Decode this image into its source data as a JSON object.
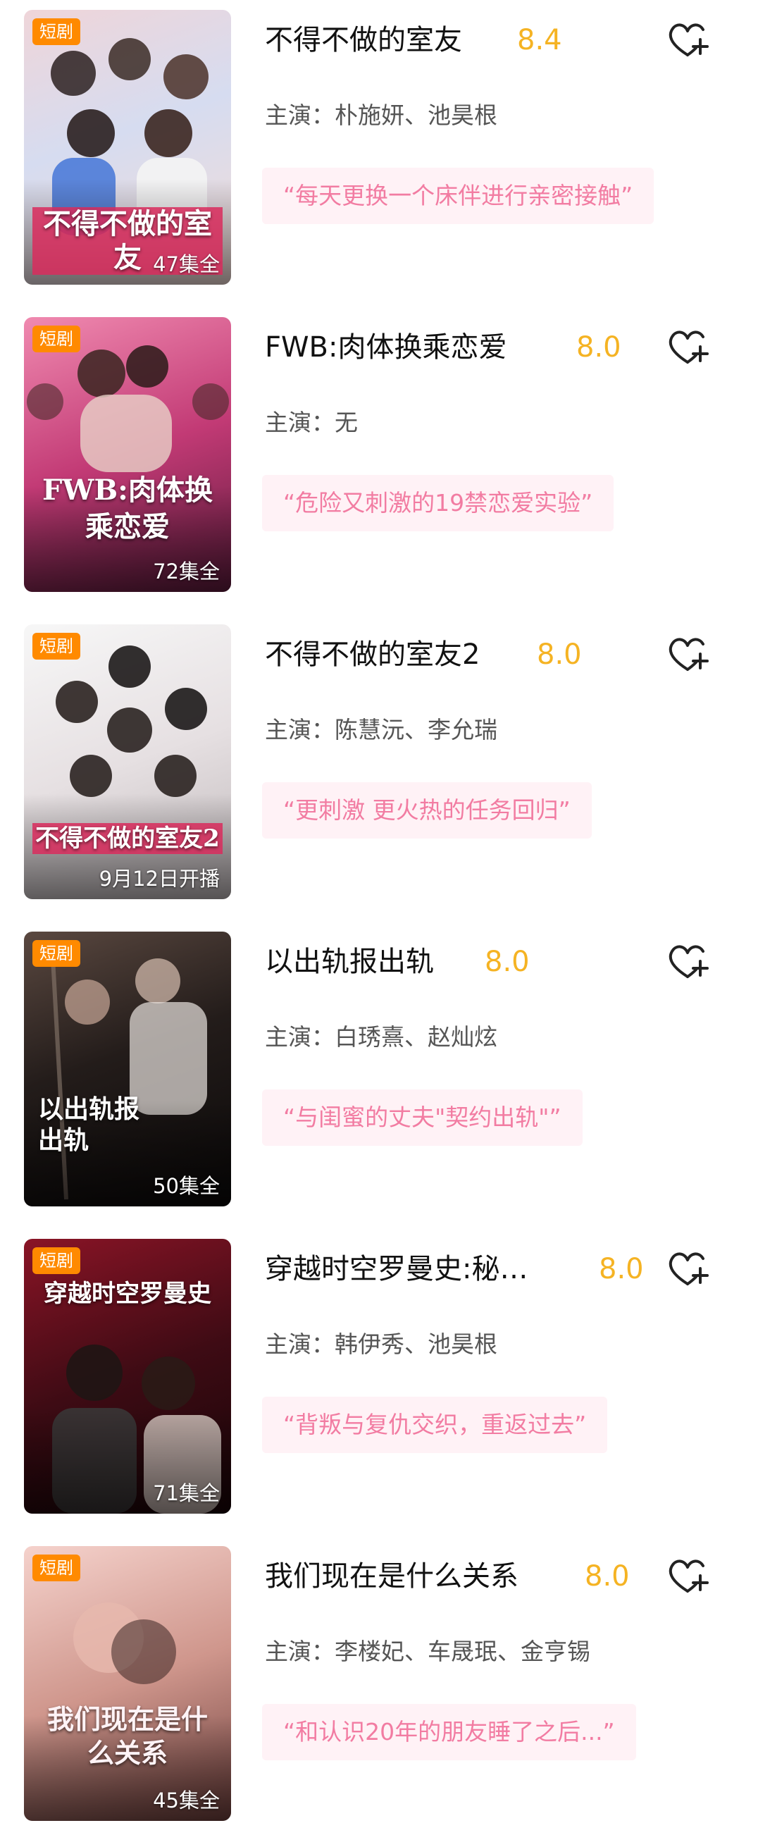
{
  "items": [
    {
      "badge": "短剧",
      "poster_title": "不得不做的室友",
      "episodes": "47集全",
      "title": "不得不做的室友",
      "score": "8.4",
      "cast_label": "主演：朴施妍、池昊根",
      "tagline": "“每天更换一个床伴进行亲密接触”",
      "poster_colors": [
        "#e9c9cf",
        "#c9d5ea",
        "#f0d6d2"
      ]
    },
    {
      "badge": "短剧",
      "poster_title": "FWB:肉体换乘恋爱",
      "episodes": "72集全",
      "title": "FWB:肉体换乘恋爱",
      "score": "8.0",
      "cast_label": "主演：无",
      "tagline": "“危险又刺激的19禁恋爱实验”",
      "poster_colors": [
        "#e86a9c",
        "#b8306c",
        "#6b1f44"
      ]
    },
    {
      "badge": "短剧",
      "poster_title": "不得不做的室友2",
      "episodes": "9月12日开播",
      "title": "不得不做的室友2",
      "score": "8.0",
      "cast_label": "主演：陈慧沅、李允瑞",
      "tagline": "“更刺激 更火热的任务回归”",
      "poster_colors": [
        "#f3f3f3",
        "#e4dedf",
        "#c9c4c6"
      ]
    },
    {
      "badge": "短剧",
      "poster_title": "以出轨报出轨",
      "episodes": "50集全",
      "title": "以出轨报出轨",
      "score": "8.0",
      "cast_label": "主演：白琇熹、赵灿炫",
      "tagline": "“与闺蜜的丈夫\"契约出轨\"”",
      "poster_colors": [
        "#4a3b36",
        "#1d1716",
        "#0b0909"
      ]
    },
    {
      "badge": "短剧",
      "poster_title": "穿越时空罗曼史",
      "episodes": "71集全",
      "title": "穿越时空罗曼史:秘…",
      "score": "8.0",
      "cast_label": "主演：韩伊秀、池昊根",
      "tagline": "“背叛与复仇交织，重返过去”",
      "poster_colors": [
        "#7a1020",
        "#3b0a12",
        "#1a0508"
      ]
    },
    {
      "badge": "短剧",
      "poster_title": "我们现在是什么关系",
      "episodes": "45集全",
      "title": "我们现在是什么关系",
      "score": "8.0",
      "cast_label": "主演：李楼妃、车晟珉、金亨锡",
      "tagline": "“和认识20年的朋友睡了之后...”",
      "poster_colors": [
        "#f2c9c4",
        "#c98f86",
        "#7a4a47"
      ]
    }
  ],
  "icons": {
    "favorite": "heart-plus-icon"
  },
  "colors": {
    "score": "#f5b323",
    "badge": "#ff8a00",
    "tagline_text": "#f27ca2",
    "tagline_bg": "#fff2f6"
  }
}
